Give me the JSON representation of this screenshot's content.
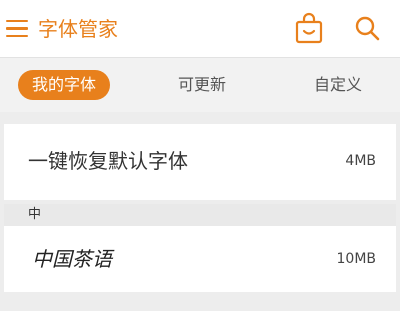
{
  "appbar": {
    "title": "字体管家",
    "menu_icon": "hamburger-menu-icon",
    "bag_icon": "shopping-bag-smile-icon",
    "search_icon": "search-icon",
    "accent_color": "#e8801c"
  },
  "tabs": [
    {
      "label": "我的字体",
      "active": true
    },
    {
      "label": "可更新",
      "active": false
    },
    {
      "label": "自定义",
      "active": false
    }
  ],
  "default_font": {
    "name": "一键恢复默认字体",
    "size": "4MB"
  },
  "section": {
    "label": "中"
  },
  "fonts": [
    {
      "name": "中国茶语",
      "size": "10MB"
    }
  ]
}
